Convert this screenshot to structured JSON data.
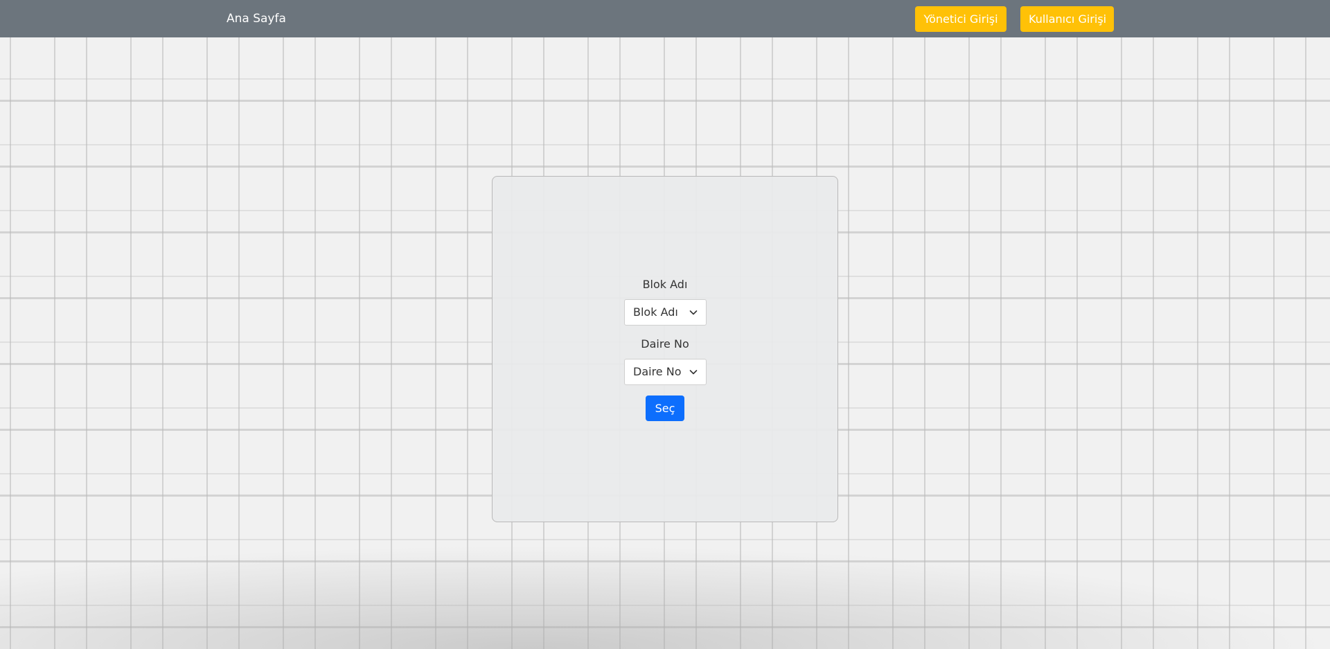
{
  "navbar": {
    "brand": "Ana Sayfa",
    "admin_login": "Yönetici Girişi",
    "user_login": "Kullanıcı Girişi"
  },
  "form": {
    "block_label": "Blok Adı",
    "block_selected": "Blok Adı",
    "flat_label": "Daire No",
    "flat_selected": "Daire No",
    "submit": "Seç"
  },
  "colors": {
    "navbar_bg": "#6c757d",
    "nav_button": "#ffc107",
    "submit_button": "#0d6efd"
  }
}
